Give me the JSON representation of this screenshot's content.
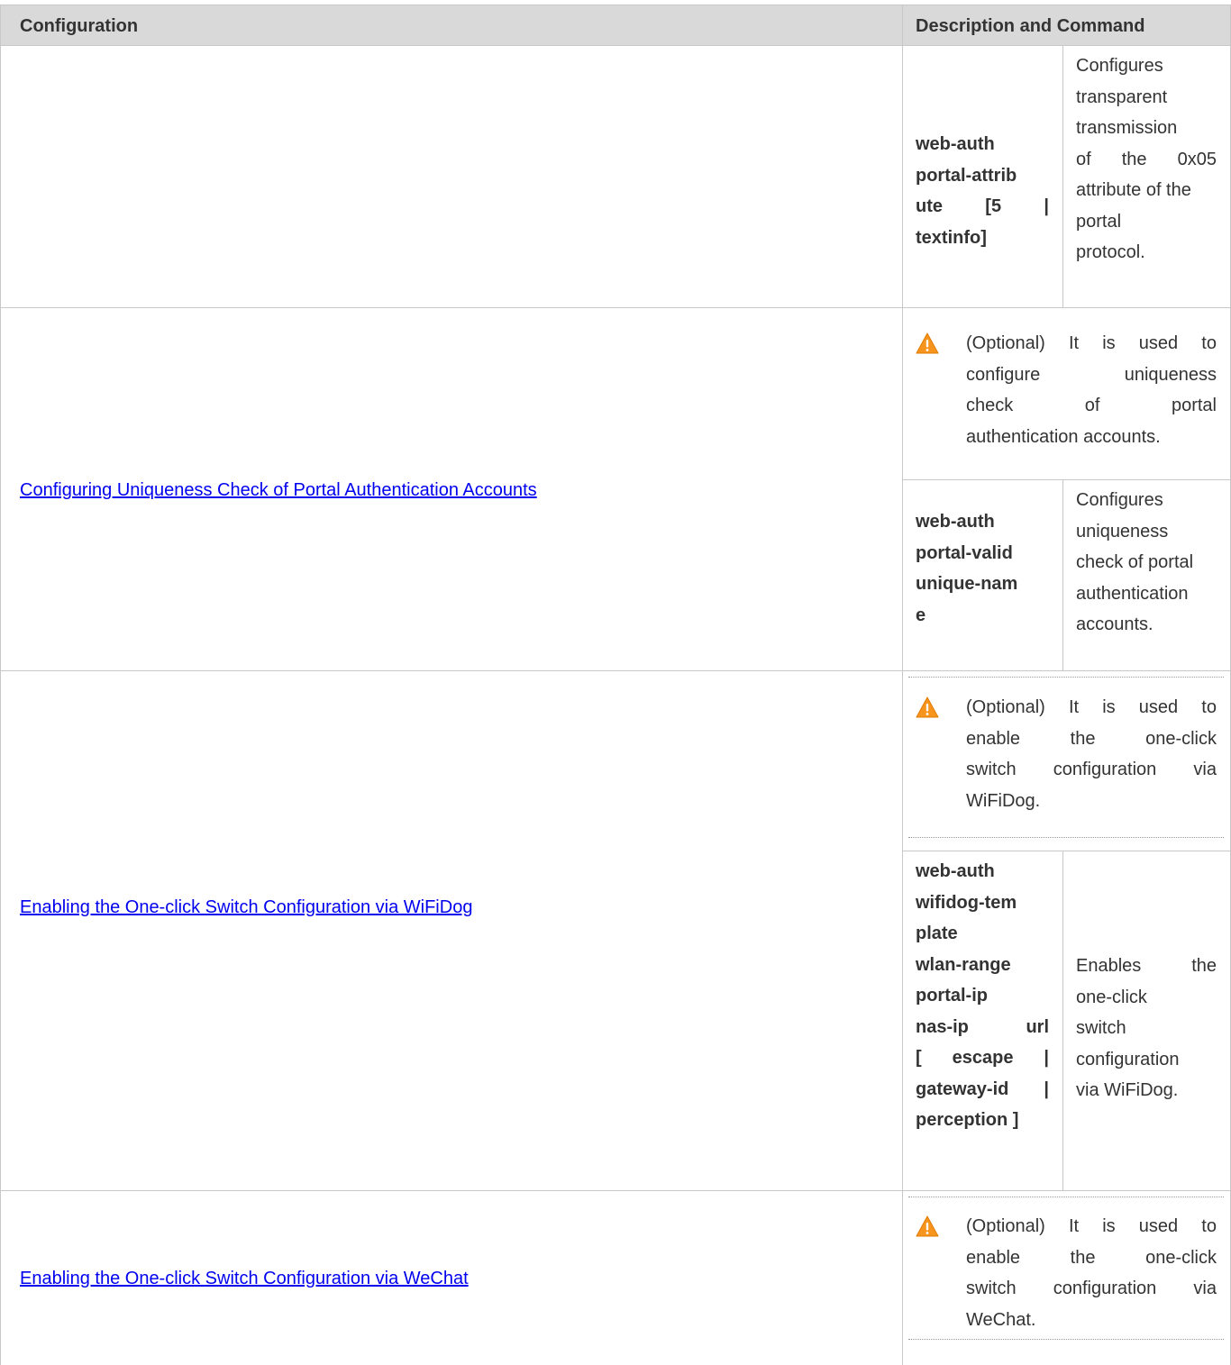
{
  "table": {
    "header": {
      "configuration": "Configuration",
      "description": "Description and Command"
    },
    "rows": [
      {
        "command_lines": [
          "web-auth",
          "portal-attrib",
          "ute [5 |",
          "textinfo]"
        ],
        "description_lines": [
          "Configures",
          "transparent",
          "transmission",
          "of the 0x05",
          "attribute of the",
          "portal",
          "protocol."
        ]
      },
      {
        "configuration_link": "Configuring Uniqueness Check of Portal Authentication Accounts",
        "note_icon": "warning-icon",
        "note_lines": [
          "(Optional) It is used to",
          "configure uniqueness",
          "check of portal",
          "authentication accounts."
        ],
        "command_lines": [
          "web-auth",
          "portal-valid",
          "unique-nam",
          "e"
        ],
        "description_lines": [
          "Configures",
          "uniqueness",
          "check of portal",
          "authentication",
          "accounts."
        ]
      },
      {
        "configuration_link": "Enabling the One-click Switch Configuration via WiFiDog",
        "note_icon": "warning-icon",
        "note_lines": [
          "(Optional) It is used to",
          "enable the one-click",
          "switch configuration via",
          "WiFiDog."
        ],
        "command_lines": [
          "web-auth",
          "wifidog-tem",
          "plate",
          "wlan-range",
          "portal-ip",
          "nas-ip url",
          "[ escape |",
          "gateway-id |",
          "perception ]"
        ],
        "description_lines": [
          "Enables the",
          "one-click",
          "switch",
          "configuration",
          "via WiFiDog."
        ]
      },
      {
        "configuration_link": "Enabling the One-click Switch Configuration via WeChat",
        "note_icon": "warning-icon",
        "note_lines": [
          "(Optional) It is used to",
          "enable the one-click",
          "switch configuration via",
          "WeChat."
        ]
      }
    ]
  },
  "colors": {
    "header_bg": "#d9d9d9",
    "border": "#c8c8c8",
    "link": "#0000ee",
    "warning": "#f7941d"
  }
}
